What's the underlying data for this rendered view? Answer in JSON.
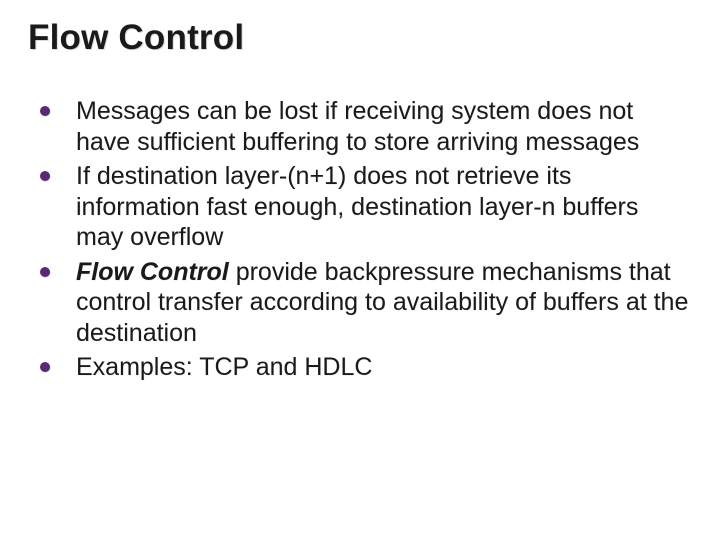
{
  "slide": {
    "title": "Flow Control",
    "bullets": [
      {
        "text": "Messages can be lost if receiving system does not have sufficient buffering to store arriving messages"
      },
      {
        "text": "If destination layer-(n+1) does not retrieve its information fast enough, destination layer-n buffers may overflow"
      },
      {
        "emphasis": "Flow Control",
        "text": " provide backpressure mechanisms that control transfer according to availability of buffers at the destination"
      },
      {
        "text": "Examples:  TCP and HDLC"
      }
    ]
  }
}
